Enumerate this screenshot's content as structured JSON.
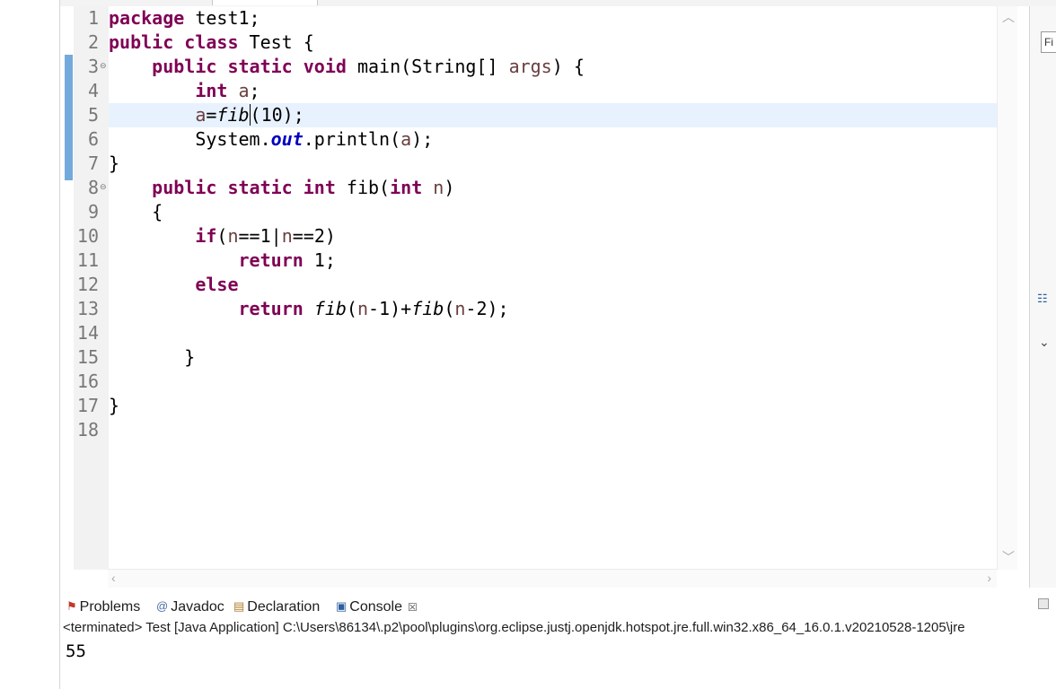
{
  "editor": {
    "lines": [
      {
        "num": "1"
      },
      {
        "num": "2"
      },
      {
        "num": "3"
      },
      {
        "num": "4"
      },
      {
        "num": "5"
      },
      {
        "num": "6"
      },
      {
        "num": "7"
      },
      {
        "num": "8"
      },
      {
        "num": "9"
      },
      {
        "num": "10"
      },
      {
        "num": "11"
      },
      {
        "num": "12"
      },
      {
        "num": "13"
      },
      {
        "num": "14"
      },
      {
        "num": "15"
      },
      {
        "num": "16"
      },
      {
        "num": "17"
      },
      {
        "num": "18"
      }
    ],
    "code": {
      "l1a": "package",
      "l1b": " test1;",
      "l2a": "public",
      "l2b": " ",
      "l2c": "class",
      "l2d": " Test {",
      "l3a": "    ",
      "l3b": "public",
      "l3c": " ",
      "l3d": "static",
      "l3e": " ",
      "l3f": "void",
      "l3g": " main(String[] ",
      "l3h": "args",
      "l3i": ") {",
      "l4a": "        ",
      "l4b": "int",
      "l4c": " ",
      "l4d": "a",
      "l4e": ";",
      "l5a": "        ",
      "l5b": "a",
      "l5c": "=",
      "l5d": "fib",
      "l5e": "(",
      "l5f": "10);",
      "l6a": "        System.",
      "l6b": "out",
      "l6c": ".println(",
      "l6d": "a",
      "l6e": ");",
      "l7a": "}",
      "l8a": "    ",
      "l8b": "public",
      "l8c": " ",
      "l8d": "static",
      "l8e": " ",
      "l8f": "int",
      "l8g": " fib(",
      "l8h": "int",
      "l8i": " ",
      "l8j": "n",
      "l8k": ")",
      "l9a": "    {",
      "l10a": "        ",
      "l10b": "if",
      "l10c": "(",
      "l10d": "n",
      "l10e": "==1|",
      "l10f": "n",
      "l10g": "==2)",
      "l11a": "            ",
      "l11b": "return",
      "l11c": " 1;",
      "l12a": "        ",
      "l12b": "else",
      "l13a": "            ",
      "l13b": "return",
      "l13c": " ",
      "l13d": "fib",
      "l13e": "(",
      "l13f": "n",
      "l13g": "-1)+",
      "l13h": "fib",
      "l13i": "(",
      "l13j": "n",
      "l13k": "-2);",
      "l15a": "       }",
      "l17a": "}"
    }
  },
  "right_panel": {
    "find_placeholder": "Fi"
  },
  "views": {
    "tabs": [
      {
        "label": "Problems",
        "icon": "problems-icon"
      },
      {
        "label": "Javadoc",
        "icon": "javadoc-icon"
      },
      {
        "label": "Declaration",
        "icon": "declaration-icon"
      },
      {
        "label": "Console",
        "icon": "console-icon",
        "active": true
      }
    ],
    "close_glyph": "☒"
  },
  "console": {
    "header": "<terminated> Test [Java Application] C:\\Users\\86134\\.p2\\pool\\plugins\\org.eclipse.justj.openjdk.hotspot.jre.full.win32.x86_64_16.0.1.v20210528-1205\\jre",
    "output": "55"
  },
  "colors": {
    "keyword": "#7f0055",
    "variable": "#6a3e3e",
    "field": "#0000c0",
    "current_line": "#e8f2fe",
    "change_bar": "#5b9bd5"
  }
}
